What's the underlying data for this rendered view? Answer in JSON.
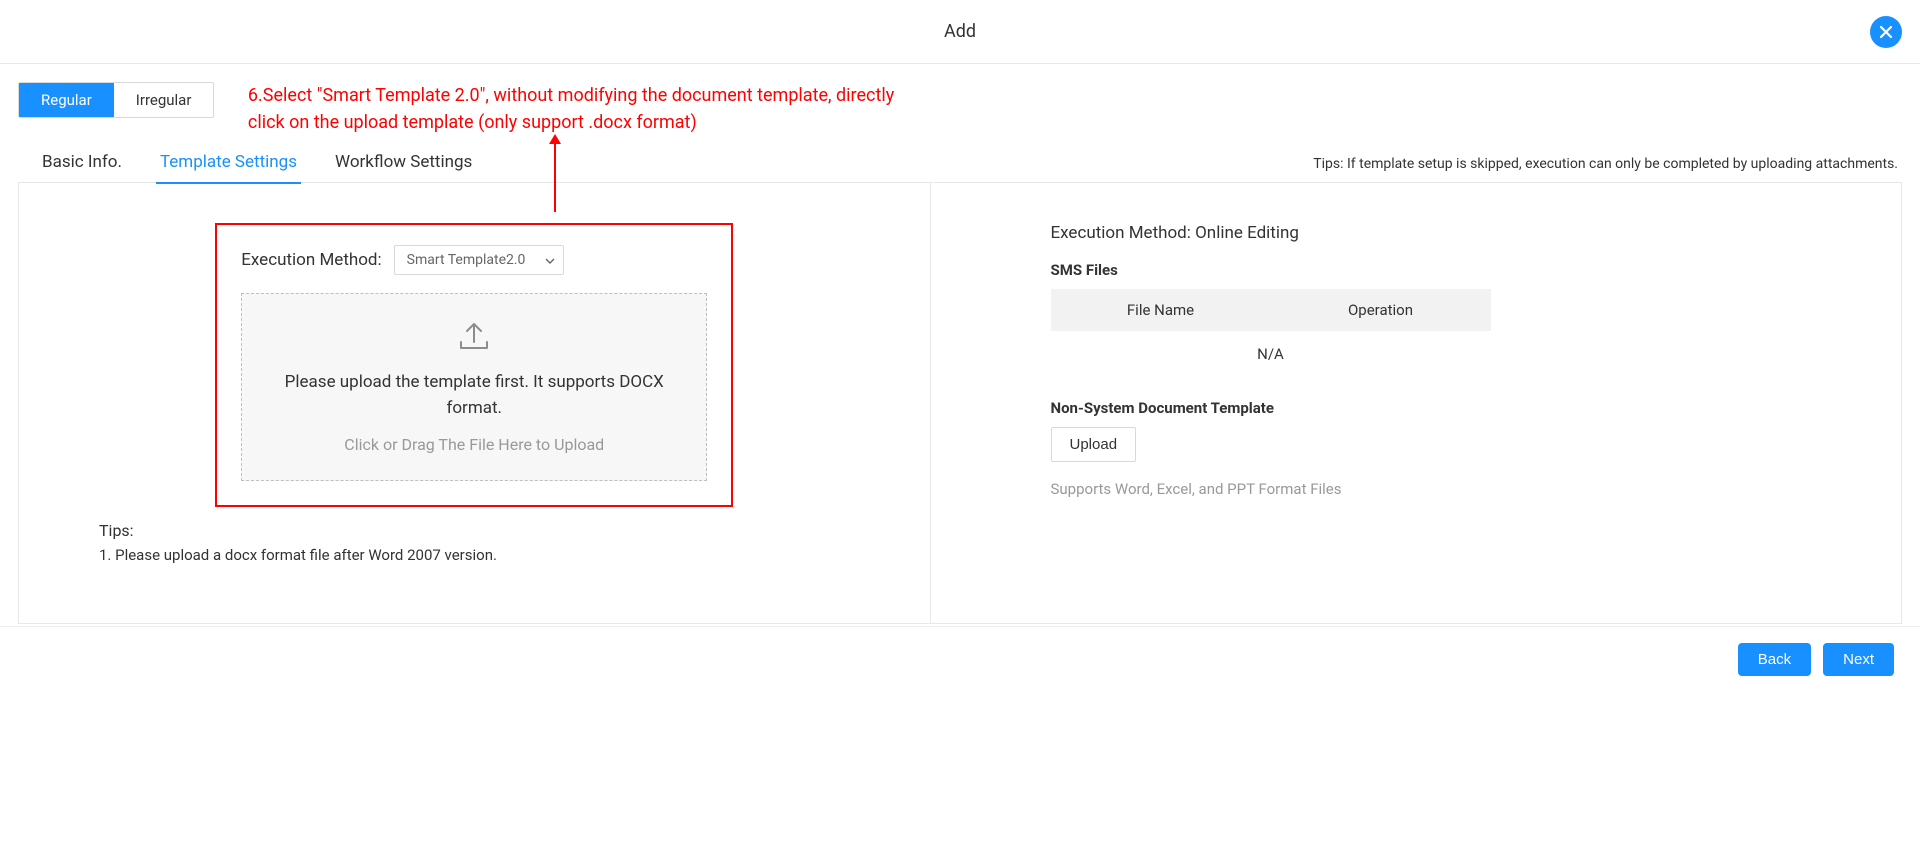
{
  "modal": {
    "title": "Add"
  },
  "instruction": "6.Select \"Smart Template 2.0\", without modifying the document template, directly click on the upload template (only support .docx format)",
  "typeTabs": {
    "regular": "Regular",
    "irregular": "Irregular"
  },
  "subTabs": {
    "basicInfo": "Basic Info.",
    "templateSettings": "Template Settings",
    "workflowSettings": "Workflow Settings"
  },
  "tipsTop": "Tips: If template setup is skipped, execution can only be completed by uploading attachments.",
  "left": {
    "execLabel": "Execution Method:",
    "execValue": "Smart Template2.0",
    "uploadMsg1": "Please upload the template first. It supports DOCX format.",
    "uploadMsg2": "Click or Drag The File Here to Upload",
    "tipsHeading": "Tips:",
    "tipsLine1": "1. Please upload a docx format file after Word 2007 version."
  },
  "right": {
    "heading": "Execution Method: Online Editing",
    "smsFiles": "SMS Files",
    "table": {
      "col1": "File Name",
      "col2": "Operation",
      "empty": "N/A"
    },
    "nonSys": "Non-System Document Template",
    "uploadBtn": "Upload",
    "hint": "Supports Word, Excel, and PPT Format Files"
  },
  "footer": {
    "back": "Back",
    "next": "Next"
  }
}
